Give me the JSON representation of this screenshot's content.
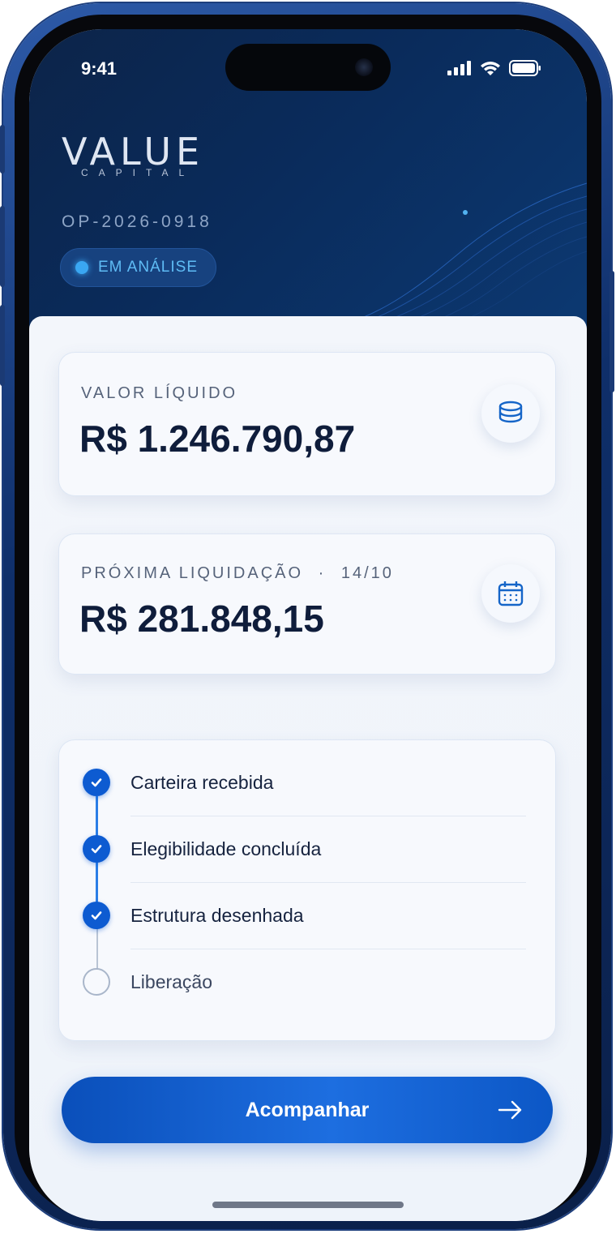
{
  "status_bar": {
    "time": "9:41"
  },
  "brand": {
    "name": "VALUE",
    "sub": "CAPITAL"
  },
  "operation": {
    "id": "OP-2026-0918",
    "status": "EM ANÁLISE"
  },
  "cards": {
    "net_value": {
      "label": "VALOR LÍQUIDO",
      "value": "R$ 1.246.790,87",
      "icon": "coins-stack-icon"
    },
    "next_settlement": {
      "label": "PRÓXIMA LIQUIDAÇÃO",
      "separator": "·",
      "date": "14/10",
      "value": "R$ 281.848,15",
      "icon": "calendar-icon"
    }
  },
  "timeline": {
    "steps": [
      {
        "label": "Carteira recebida",
        "done": true
      },
      {
        "label": "Elegibilidade concluída",
        "done": true
      },
      {
        "label": "Estrutura desenhada",
        "done": true
      },
      {
        "label": "Liberação",
        "done": false
      }
    ]
  },
  "cta": {
    "label": "Acompanhar",
    "icon": "arrow-right-icon"
  },
  "colors": {
    "accent": "#0d5bd1",
    "hero_bg": "#0a2b5b",
    "badge_text": "#5fbcf5",
    "text_primary": "#0f1d3b"
  }
}
